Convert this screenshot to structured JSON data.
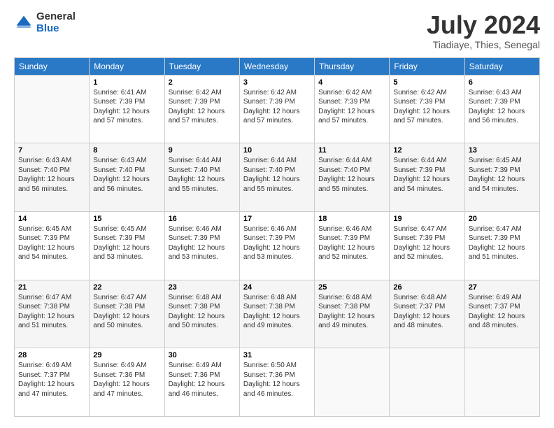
{
  "logo": {
    "general": "General",
    "blue": "Blue"
  },
  "header": {
    "month": "July 2024",
    "location": "Tiadiaye, Thies, Senegal"
  },
  "weekdays": [
    "Sunday",
    "Monday",
    "Tuesday",
    "Wednesday",
    "Thursday",
    "Friday",
    "Saturday"
  ],
  "weeks": [
    [
      {
        "day": "",
        "info": ""
      },
      {
        "day": "1",
        "info": "Sunrise: 6:41 AM\nSunset: 7:39 PM\nDaylight: 12 hours\nand 57 minutes."
      },
      {
        "day": "2",
        "info": "Sunrise: 6:42 AM\nSunset: 7:39 PM\nDaylight: 12 hours\nand 57 minutes."
      },
      {
        "day": "3",
        "info": "Sunrise: 6:42 AM\nSunset: 7:39 PM\nDaylight: 12 hours\nand 57 minutes."
      },
      {
        "day": "4",
        "info": "Sunrise: 6:42 AM\nSunset: 7:39 PM\nDaylight: 12 hours\nand 57 minutes."
      },
      {
        "day": "5",
        "info": "Sunrise: 6:42 AM\nSunset: 7:39 PM\nDaylight: 12 hours\nand 57 minutes."
      },
      {
        "day": "6",
        "info": "Sunrise: 6:43 AM\nSunset: 7:39 PM\nDaylight: 12 hours\nand 56 minutes."
      }
    ],
    [
      {
        "day": "7",
        "info": "Sunrise: 6:43 AM\nSunset: 7:40 PM\nDaylight: 12 hours\nand 56 minutes."
      },
      {
        "day": "8",
        "info": "Sunrise: 6:43 AM\nSunset: 7:40 PM\nDaylight: 12 hours\nand 56 minutes."
      },
      {
        "day": "9",
        "info": "Sunrise: 6:44 AM\nSunset: 7:40 PM\nDaylight: 12 hours\nand 55 minutes."
      },
      {
        "day": "10",
        "info": "Sunrise: 6:44 AM\nSunset: 7:40 PM\nDaylight: 12 hours\nand 55 minutes."
      },
      {
        "day": "11",
        "info": "Sunrise: 6:44 AM\nSunset: 7:40 PM\nDaylight: 12 hours\nand 55 minutes."
      },
      {
        "day": "12",
        "info": "Sunrise: 6:44 AM\nSunset: 7:39 PM\nDaylight: 12 hours\nand 54 minutes."
      },
      {
        "day": "13",
        "info": "Sunrise: 6:45 AM\nSunset: 7:39 PM\nDaylight: 12 hours\nand 54 minutes."
      }
    ],
    [
      {
        "day": "14",
        "info": "Sunrise: 6:45 AM\nSunset: 7:39 PM\nDaylight: 12 hours\nand 54 minutes."
      },
      {
        "day": "15",
        "info": "Sunrise: 6:45 AM\nSunset: 7:39 PM\nDaylight: 12 hours\nand 53 minutes."
      },
      {
        "day": "16",
        "info": "Sunrise: 6:46 AM\nSunset: 7:39 PM\nDaylight: 12 hours\nand 53 minutes."
      },
      {
        "day": "17",
        "info": "Sunrise: 6:46 AM\nSunset: 7:39 PM\nDaylight: 12 hours\nand 53 minutes."
      },
      {
        "day": "18",
        "info": "Sunrise: 6:46 AM\nSunset: 7:39 PM\nDaylight: 12 hours\nand 52 minutes."
      },
      {
        "day": "19",
        "info": "Sunrise: 6:47 AM\nSunset: 7:39 PM\nDaylight: 12 hours\nand 52 minutes."
      },
      {
        "day": "20",
        "info": "Sunrise: 6:47 AM\nSunset: 7:39 PM\nDaylight: 12 hours\nand 51 minutes."
      }
    ],
    [
      {
        "day": "21",
        "info": "Sunrise: 6:47 AM\nSunset: 7:38 PM\nDaylight: 12 hours\nand 51 minutes."
      },
      {
        "day": "22",
        "info": "Sunrise: 6:47 AM\nSunset: 7:38 PM\nDaylight: 12 hours\nand 50 minutes."
      },
      {
        "day": "23",
        "info": "Sunrise: 6:48 AM\nSunset: 7:38 PM\nDaylight: 12 hours\nand 50 minutes."
      },
      {
        "day": "24",
        "info": "Sunrise: 6:48 AM\nSunset: 7:38 PM\nDaylight: 12 hours\nand 49 minutes."
      },
      {
        "day": "25",
        "info": "Sunrise: 6:48 AM\nSunset: 7:38 PM\nDaylight: 12 hours\nand 49 minutes."
      },
      {
        "day": "26",
        "info": "Sunrise: 6:48 AM\nSunset: 7:37 PM\nDaylight: 12 hours\nand 48 minutes."
      },
      {
        "day": "27",
        "info": "Sunrise: 6:49 AM\nSunset: 7:37 PM\nDaylight: 12 hours\nand 48 minutes."
      }
    ],
    [
      {
        "day": "28",
        "info": "Sunrise: 6:49 AM\nSunset: 7:37 PM\nDaylight: 12 hours\nand 47 minutes."
      },
      {
        "day": "29",
        "info": "Sunrise: 6:49 AM\nSunset: 7:36 PM\nDaylight: 12 hours\nand 47 minutes."
      },
      {
        "day": "30",
        "info": "Sunrise: 6:49 AM\nSunset: 7:36 PM\nDaylight: 12 hours\nand 46 minutes."
      },
      {
        "day": "31",
        "info": "Sunrise: 6:50 AM\nSunset: 7:36 PM\nDaylight: 12 hours\nand 46 minutes."
      },
      {
        "day": "",
        "info": ""
      },
      {
        "day": "",
        "info": ""
      },
      {
        "day": "",
        "info": ""
      }
    ]
  ]
}
